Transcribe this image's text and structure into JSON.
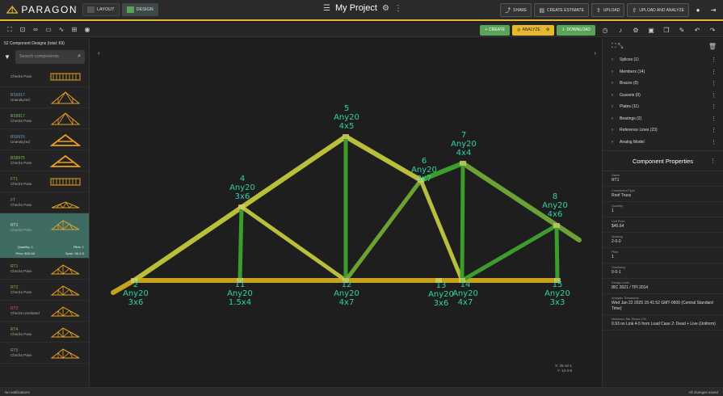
{
  "app": {
    "brand": "PARAGON",
    "modes": [
      {
        "label": "LAYOUT",
        "active": false
      },
      {
        "label": "DESIGN",
        "active": true
      }
    ],
    "project_title": "My Project",
    "actions": {
      "share": "SHARE",
      "create_estimate": "CREATE ESTIMATE",
      "upload": "UPLOAD",
      "upload_analyze": "UPLOAD AND ANALYZE"
    },
    "accent_color": "#e8b930"
  },
  "toolbar": {
    "create": "CREATE",
    "analyze": "ANALYZE",
    "download": "DOWNLOAD"
  },
  "components": {
    "header": "52 Component Designs (total: 69)",
    "search_placeholder": "Search components",
    "items": [
      {
        "name": "",
        "status": "Checks Pass",
        "name_color": "#5aa0d8",
        "thumb": "parallel"
      },
      {
        "name": "BS9917",
        "status": "Unanalyzed",
        "name_color": "#5aa0d8",
        "thumb": "fink"
      },
      {
        "name": "BS9917",
        "status": "Checks Pass",
        "name_color": "#6ec24a",
        "thumb": "fink"
      },
      {
        "name": "BS9975",
        "status": "Unanalyzed",
        "name_color": "#5aa0d8",
        "thumb": "kingpost"
      },
      {
        "name": "BS9975",
        "status": "Checks Pass",
        "name_color": "#6ec24a",
        "thumb": "kingpost"
      },
      {
        "name": "FT1",
        "status": "Checks Pass",
        "name_color": "#6ec24a",
        "thumb": "parallel"
      },
      {
        "name": "FT",
        "status": "Checks Pass",
        "name_color": "#6ec24a",
        "thumb": "low"
      },
      {
        "name": "RT1",
        "status": "Checks Pass",
        "name_color": "#dddddd",
        "thumb": "roof",
        "selected": true,
        "quantity": "Quantity: 1",
        "plies": "Plies: 1",
        "price": "Price: $45.64",
        "span": "Span: 38-2-0"
      },
      {
        "name": "RT1",
        "status": "Checks Pass",
        "name_color": "#6ec24a",
        "thumb": "roof"
      },
      {
        "name": "RT2",
        "status": "Checks Pass",
        "name_color": "#6ec24a",
        "thumb": "roof"
      },
      {
        "name": "RT3",
        "status": "Checks Unrelated",
        "name_color": "#e04b4b",
        "thumb": "roof"
      },
      {
        "name": "RT4",
        "status": "Checks Pass",
        "name_color": "#6ec24a",
        "thumb": "roof"
      },
      {
        "name": "RT5",
        "status": "Checks Pass",
        "name_color": "#5aa0d8",
        "thumb": "roof"
      }
    ]
  },
  "truss": {
    "colors": {
      "chord": "#c5a11f",
      "web_yellow": "#b9bf3a",
      "web_green": "#3c9c2c",
      "label": "#31d1a6"
    },
    "joints": [
      {
        "id": "2",
        "lines": [
          "2",
          "Any20",
          "3x6"
        ]
      },
      {
        "id": "4",
        "lines": [
          "4",
          "Any20",
          "3x6"
        ]
      },
      {
        "id": "5",
        "lines": [
          "5",
          "Any20",
          "4x5"
        ]
      },
      {
        "id": "6",
        "lines": [
          "6",
          "Any20",
          "3x7"
        ]
      },
      {
        "id": "7",
        "lines": [
          "7",
          "Any20",
          "4x4"
        ]
      },
      {
        "id": "8",
        "lines": [
          "8",
          "Any20",
          "4x6"
        ]
      },
      {
        "id": "11",
        "lines": [
          "11",
          "Any20",
          "1.5x4"
        ]
      },
      {
        "id": "12",
        "lines": [
          "12",
          "Any20",
          "4x7"
        ]
      },
      {
        "id": "13",
        "lines": [
          "13",
          "Any20",
          "3x6"
        ]
      },
      {
        "id": "14",
        "lines": [
          "14",
          "Any20",
          "4x7"
        ]
      },
      {
        "id": "15",
        "lines": [
          "15",
          "Any20",
          "3x3"
        ]
      }
    ],
    "coord_readout": [
      "X: 25-10-1",
      "Y: 13-4-6"
    ]
  },
  "tree": [
    {
      "label": "Splices (1)"
    },
    {
      "label": "Members (14)"
    },
    {
      "label": "Braces (0)"
    },
    {
      "label": "Gussets (0)"
    },
    {
      "label": "Plates (11)"
    },
    {
      "label": "Bearings (2)"
    },
    {
      "label": "Reference Lines (23)"
    },
    {
      "label": "Analog Model"
    }
  ],
  "properties": {
    "header": "Component Properties",
    "fields": [
      {
        "label": "Name",
        "value": "RT1"
      },
      {
        "label": "Component Type",
        "value": "Roof Truss"
      },
      {
        "label": "Quantity",
        "value": "1"
      },
      {
        "label": "Unit Price",
        "value": "$45.64"
      },
      {
        "label": "Spacing",
        "value": "2-0-0"
      },
      {
        "label": "Plies",
        "value": "1"
      },
      {
        "label": "Overhang",
        "value": "0-0-1"
      },
      {
        "label": "Design Code",
        "value": "IBC 2021 / TPI 2014"
      },
      {
        "label": "Analysis Timestamp",
        "value": "Wed Jan 22 2025 15:41:52 GMT-0600 (Central Standard Time)"
      },
      {
        "label": "Maximum Bar Stress CSI",
        "value": "0.93 on Link 4-5 from Load Case 2: Dead + Live (Uniform)"
      }
    ]
  },
  "status": {
    "left": "No notifications",
    "right": "All changes saved"
  }
}
